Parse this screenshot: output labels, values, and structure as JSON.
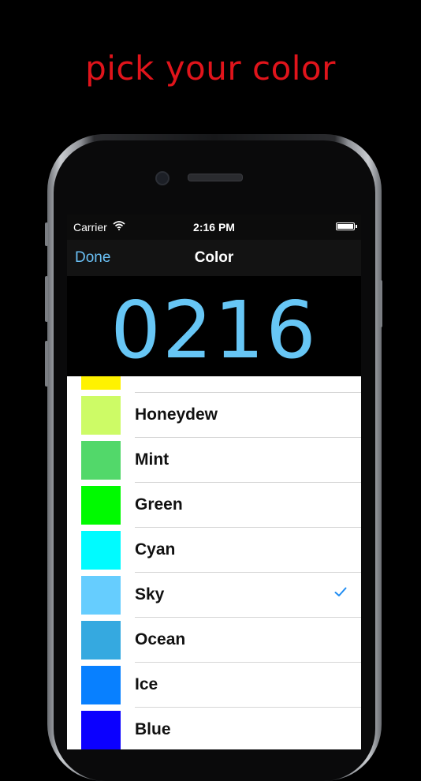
{
  "headline": "pick your color",
  "status_bar": {
    "carrier": "Carrier",
    "time": "2:16 PM"
  },
  "nav": {
    "done_label": "Done",
    "title": "Color"
  },
  "clock_display": "0216",
  "colors": [
    {
      "label": "",
      "color": "#fff200"
    },
    {
      "label": "Honeydew",
      "color": "#cdfb66"
    },
    {
      "label": "Mint",
      "color": "#52d86a"
    },
    {
      "label": "Green",
      "color": "#00fa00"
    },
    {
      "label": "Cyan",
      "color": "#00fbff"
    },
    {
      "label": "Sky",
      "color": "#66cdfe",
      "selected": true
    },
    {
      "label": "Ocean",
      "color": "#35a9e0"
    },
    {
      "label": "Ice",
      "color": "#0880ff"
    },
    {
      "label": "Blue",
      "color": "#0b00ff"
    }
  ],
  "accent_color": "#1f8cf2",
  "headline_color": "#e0141b"
}
